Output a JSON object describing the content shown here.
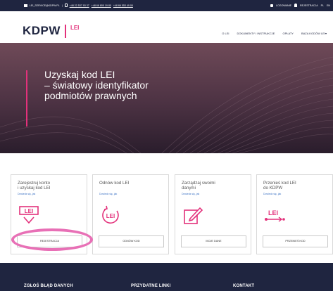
{
  "topbar": {
    "email": "LEI_SERVICE@KDPW.PL",
    "separator": "|",
    "phone1": "+48 22 537 93 37",
    "phone2": "+48 66 800 19 80",
    "phone3": "+48 66 553 49 00",
    "login": "LOGOWANIE",
    "register": "REJESTRACJA",
    "lang1": "PL",
    "lang2": "EN"
  },
  "header": {
    "logo_main": "KDPW",
    "logo_sub": "LEI",
    "nav": [
      "O LEI",
      "DOKUMENTY I INSTRUKCJE",
      "OPŁATY",
      "BAZA KODÓW LEI"
    ],
    "nav_dropdown_marker": "▾"
  },
  "hero": {
    "title_line1": "Uzyskaj kod LEI",
    "title_line2": "– światowy identyfikator",
    "title_line3": "podmiotów prawnych"
  },
  "cards": [
    {
      "title_line1": "Zarejestruj konto",
      "title_line2": "i uzyskaj kod LEI",
      "more": "Dowiedz się, jak",
      "icon_text": "LEI",
      "button": "REJESTRACJA"
    },
    {
      "title_line1": "Odnów kod LEI",
      "title_line2": "",
      "more": "Dowiedz się, jak",
      "icon_text": "LEI",
      "button": "ODNÓW KOD"
    },
    {
      "title_line1": "Zarządzaj swoimi",
      "title_line2": "danymi",
      "more": "Dowiedz się, jak",
      "icon_text": "",
      "button": "MOJE DANE"
    },
    {
      "title_line1": "Przenieś kod LEI",
      "title_line2": "do KDPW",
      "more": "Dowiedz się, jak",
      "icon_text": "LEI",
      "button": "PRZENIEŚ KOD"
    }
  ],
  "footer": {
    "col1": "ZGŁOŚ BŁĄD DANYCH",
    "col2": "PRZYDATNE LINKI",
    "col3": "KONTAKT"
  },
  "colors": {
    "navy": "#1f2540",
    "accent_pink": "#e3317b",
    "annotation_circle": "#e870b6",
    "link_blue": "#3c72c4"
  }
}
